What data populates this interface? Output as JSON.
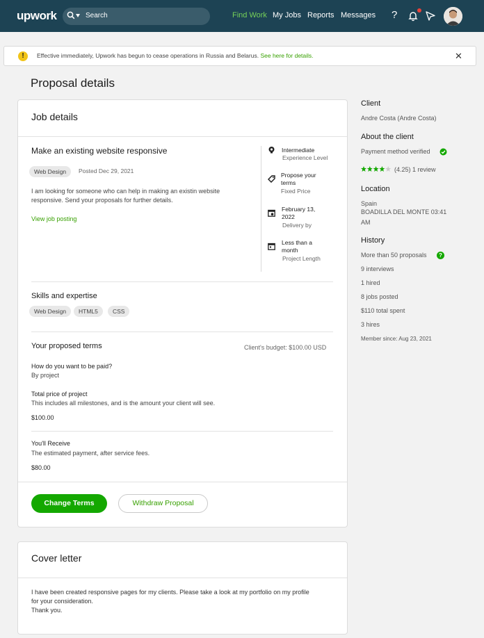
{
  "header": {
    "logo": "upwork",
    "search_label": "Search",
    "nav": [
      "Find Work",
      "My Jobs",
      "Reports",
      "Messages"
    ],
    "help_label": "?",
    "accent_color": "#76d158"
  },
  "alert": {
    "text": "Effective immediately, Upwork has begun to cease operations in Russia and Belarus.",
    "link": "See here for details.",
    "icon": "!",
    "close": "✕"
  },
  "page_title": "Proposal details",
  "job": {
    "card_title": "Job details",
    "title": "Make an existing website responsive",
    "category": "Web Design",
    "posted": "Posted Dec 29, 2021",
    "description_line1": "I am looking for someone who can help in making an existin website",
    "description_line2": "responsive. Send your proposals for further details.",
    "view_link": "View job posting",
    "attributes": [
      {
        "icon": "brain-icon",
        "value_lines": [
          "Intermediate"
        ],
        "label": "Experience Level"
      },
      {
        "icon": "tag-icon",
        "value_lines": [
          "Propose your",
          "terms"
        ],
        "label": "Fixed Price"
      },
      {
        "icon": "calendar-clock-icon",
        "value_lines": [
          "February 13,",
          "2022"
        ],
        "label": "Delivery by"
      },
      {
        "icon": "calendar-icon",
        "value_lines": [
          "Less than a",
          "month"
        ],
        "label": "Project Length"
      }
    ],
    "skills_title": "Skills and expertise",
    "skills": [
      "Web Design",
      "HTML5",
      "CSS"
    ]
  },
  "terms": {
    "title": "Your proposed terms",
    "budget": "Client's budget: $100.00 USD",
    "paid_q": "How do you want to be paid?",
    "paid_a": "By project",
    "total_title": "Total price of project",
    "total_desc": "This includes all milestones, and is the amount your client will see.",
    "total_value": "$100.00",
    "receive_title": "You'll Receive",
    "receive_desc": "The estimated payment, after service fees.",
    "receive_value": "$80.00"
  },
  "buttons": {
    "change": "Change Terms",
    "withdraw": "Withdraw Proposal"
  },
  "cover": {
    "title": "Cover letter",
    "line1": "I have been created responsive pages for my clients. Please take a look at my portfolio on my profile",
    "line2": "for your consideration.",
    "line3": "Thank you."
  },
  "sidebar": {
    "client_h": "Client",
    "client_name": "Andre Costa (Andre Costa)",
    "about_h": "About the client",
    "payment": "Payment method verified",
    "stars": 4.25,
    "rating": "(4.25) 1 review",
    "location_h": "Location",
    "country": "Spain",
    "city_line1": "BOADILLA DEL MONTE 03:41",
    "city_line2": "AM",
    "history_h": "History",
    "proposals": "More than 50 proposals",
    "interviews": "9 interviews",
    "hired": "1 hired",
    "jobs_posted": "8 jobs posted",
    "spent": "$110 total spent",
    "hires": "3 hires",
    "member": "Member since: Aug 23, 2021"
  }
}
